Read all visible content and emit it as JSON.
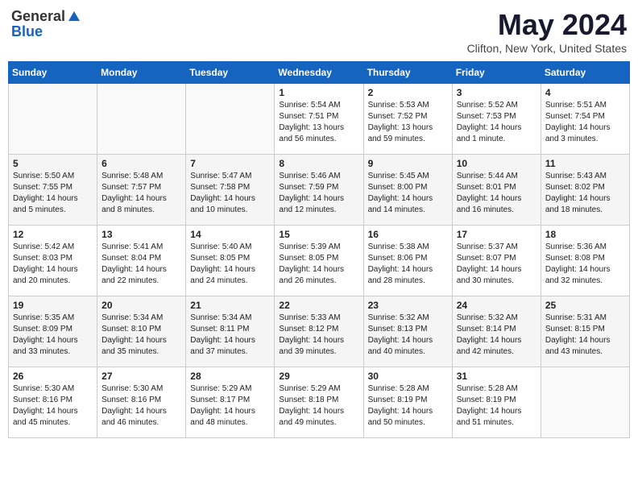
{
  "header": {
    "logo_general": "General",
    "logo_blue": "Blue",
    "month_title": "May 2024",
    "location": "Clifton, New York, United States"
  },
  "days_of_week": [
    "Sunday",
    "Monday",
    "Tuesday",
    "Wednesday",
    "Thursday",
    "Friday",
    "Saturday"
  ],
  "weeks": [
    [
      {
        "day": "",
        "info": ""
      },
      {
        "day": "",
        "info": ""
      },
      {
        "day": "",
        "info": ""
      },
      {
        "day": "1",
        "info": "Sunrise: 5:54 AM\nSunset: 7:51 PM\nDaylight: 13 hours\nand 56 minutes."
      },
      {
        "day": "2",
        "info": "Sunrise: 5:53 AM\nSunset: 7:52 PM\nDaylight: 13 hours\nand 59 minutes."
      },
      {
        "day": "3",
        "info": "Sunrise: 5:52 AM\nSunset: 7:53 PM\nDaylight: 14 hours\nand 1 minute."
      },
      {
        "day": "4",
        "info": "Sunrise: 5:51 AM\nSunset: 7:54 PM\nDaylight: 14 hours\nand 3 minutes."
      }
    ],
    [
      {
        "day": "5",
        "info": "Sunrise: 5:50 AM\nSunset: 7:55 PM\nDaylight: 14 hours\nand 5 minutes."
      },
      {
        "day": "6",
        "info": "Sunrise: 5:48 AM\nSunset: 7:57 PM\nDaylight: 14 hours\nand 8 minutes."
      },
      {
        "day": "7",
        "info": "Sunrise: 5:47 AM\nSunset: 7:58 PM\nDaylight: 14 hours\nand 10 minutes."
      },
      {
        "day": "8",
        "info": "Sunrise: 5:46 AM\nSunset: 7:59 PM\nDaylight: 14 hours\nand 12 minutes."
      },
      {
        "day": "9",
        "info": "Sunrise: 5:45 AM\nSunset: 8:00 PM\nDaylight: 14 hours\nand 14 minutes."
      },
      {
        "day": "10",
        "info": "Sunrise: 5:44 AM\nSunset: 8:01 PM\nDaylight: 14 hours\nand 16 minutes."
      },
      {
        "day": "11",
        "info": "Sunrise: 5:43 AM\nSunset: 8:02 PM\nDaylight: 14 hours\nand 18 minutes."
      }
    ],
    [
      {
        "day": "12",
        "info": "Sunrise: 5:42 AM\nSunset: 8:03 PM\nDaylight: 14 hours\nand 20 minutes."
      },
      {
        "day": "13",
        "info": "Sunrise: 5:41 AM\nSunset: 8:04 PM\nDaylight: 14 hours\nand 22 minutes."
      },
      {
        "day": "14",
        "info": "Sunrise: 5:40 AM\nSunset: 8:05 PM\nDaylight: 14 hours\nand 24 minutes."
      },
      {
        "day": "15",
        "info": "Sunrise: 5:39 AM\nSunset: 8:05 PM\nDaylight: 14 hours\nand 26 minutes."
      },
      {
        "day": "16",
        "info": "Sunrise: 5:38 AM\nSunset: 8:06 PM\nDaylight: 14 hours\nand 28 minutes."
      },
      {
        "day": "17",
        "info": "Sunrise: 5:37 AM\nSunset: 8:07 PM\nDaylight: 14 hours\nand 30 minutes."
      },
      {
        "day": "18",
        "info": "Sunrise: 5:36 AM\nSunset: 8:08 PM\nDaylight: 14 hours\nand 32 minutes."
      }
    ],
    [
      {
        "day": "19",
        "info": "Sunrise: 5:35 AM\nSunset: 8:09 PM\nDaylight: 14 hours\nand 33 minutes."
      },
      {
        "day": "20",
        "info": "Sunrise: 5:34 AM\nSunset: 8:10 PM\nDaylight: 14 hours\nand 35 minutes."
      },
      {
        "day": "21",
        "info": "Sunrise: 5:34 AM\nSunset: 8:11 PM\nDaylight: 14 hours\nand 37 minutes."
      },
      {
        "day": "22",
        "info": "Sunrise: 5:33 AM\nSunset: 8:12 PM\nDaylight: 14 hours\nand 39 minutes."
      },
      {
        "day": "23",
        "info": "Sunrise: 5:32 AM\nSunset: 8:13 PM\nDaylight: 14 hours\nand 40 minutes."
      },
      {
        "day": "24",
        "info": "Sunrise: 5:32 AM\nSunset: 8:14 PM\nDaylight: 14 hours\nand 42 minutes."
      },
      {
        "day": "25",
        "info": "Sunrise: 5:31 AM\nSunset: 8:15 PM\nDaylight: 14 hours\nand 43 minutes."
      }
    ],
    [
      {
        "day": "26",
        "info": "Sunrise: 5:30 AM\nSunset: 8:16 PM\nDaylight: 14 hours\nand 45 minutes."
      },
      {
        "day": "27",
        "info": "Sunrise: 5:30 AM\nSunset: 8:16 PM\nDaylight: 14 hours\nand 46 minutes."
      },
      {
        "day": "28",
        "info": "Sunrise: 5:29 AM\nSunset: 8:17 PM\nDaylight: 14 hours\nand 48 minutes."
      },
      {
        "day": "29",
        "info": "Sunrise: 5:29 AM\nSunset: 8:18 PM\nDaylight: 14 hours\nand 49 minutes."
      },
      {
        "day": "30",
        "info": "Sunrise: 5:28 AM\nSunset: 8:19 PM\nDaylight: 14 hours\nand 50 minutes."
      },
      {
        "day": "31",
        "info": "Sunrise: 5:28 AM\nSunset: 8:19 PM\nDaylight: 14 hours\nand 51 minutes."
      },
      {
        "day": "",
        "info": ""
      }
    ]
  ]
}
